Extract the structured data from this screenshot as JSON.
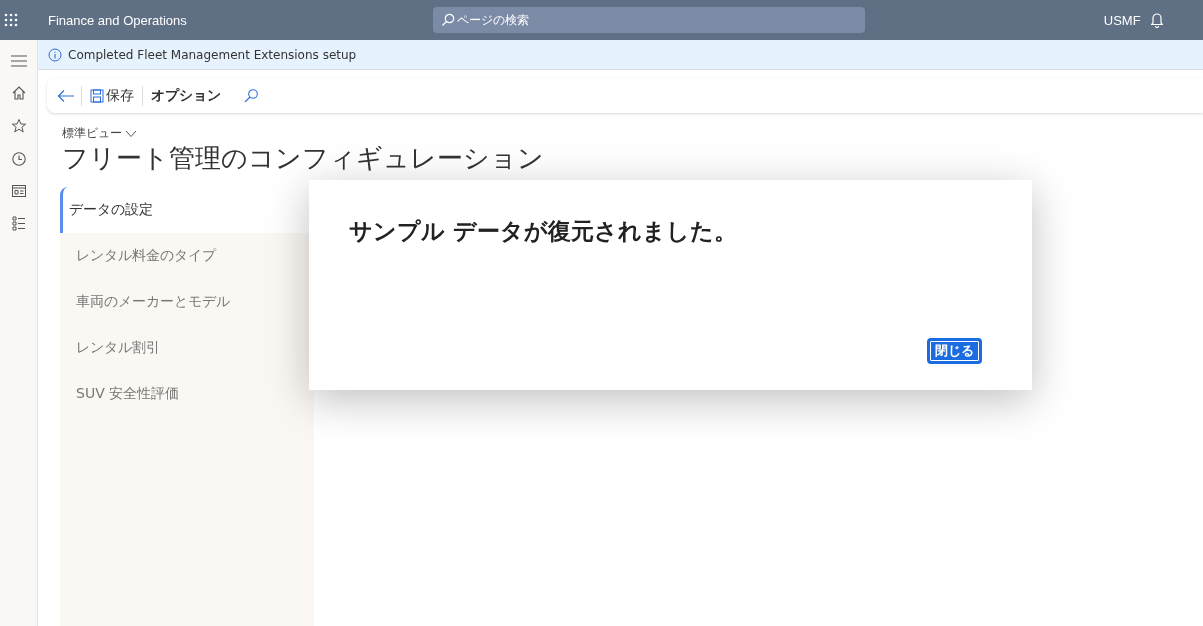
{
  "top_bar": {
    "app_name": "Finance and Operations",
    "search": {
      "placeholder": "ページの検索"
    },
    "company": "USMF"
  },
  "message_bar": {
    "text": "Completed Fleet Management Extensions setup"
  },
  "toolbar": {
    "save": "保存",
    "options": "オプション"
  },
  "view_selector": "標準ビュー",
  "page_title": "フリート管理のコンフィギュレーション",
  "nav": {
    "items": [
      {
        "label": "データの設定",
        "selected": true
      },
      {
        "label": "レンタル料金のタイプ",
        "selected": false
      },
      {
        "label": "車両のメーカーとモデル",
        "selected": false
      },
      {
        "label": "レンタル割引",
        "selected": false
      },
      {
        "label": "SUV 安全性評価",
        "selected": false
      }
    ]
  },
  "dialog": {
    "message": "サンプル データが復元されました。",
    "button": "閉じる"
  }
}
